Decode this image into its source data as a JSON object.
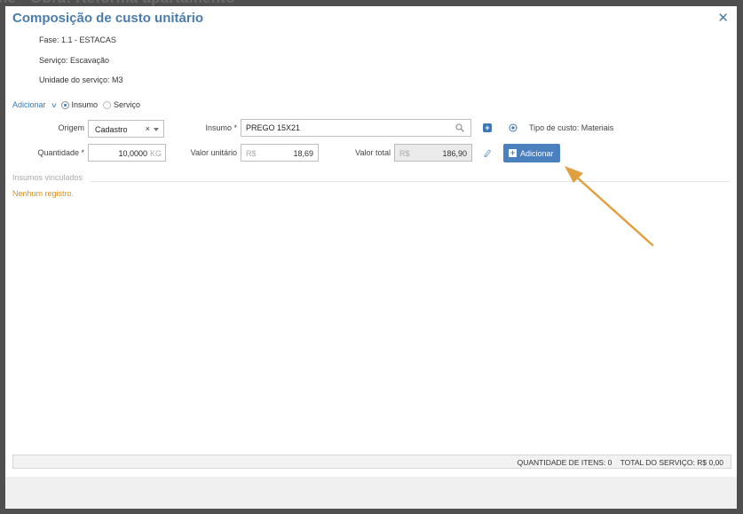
{
  "background": {
    "title": "ne - Obra: Reforma apartamento"
  },
  "modal": {
    "title": "Composição de custo unitário",
    "close_icon": "close-icon"
  },
  "info": {
    "fase": "Fase: 1.1 - ESTACAS",
    "servico": "Serviço: Escavação",
    "unidade": "Unidade do serviço: M3"
  },
  "add_mode": {
    "label": "Adicionar",
    "options": [
      {
        "label": "Insumo",
        "selected": true
      },
      {
        "label": "Serviço",
        "selected": false
      }
    ]
  },
  "form": {
    "origem_label": "Origem",
    "origem_value": "Cadastro",
    "insumo_label": "Insumo *",
    "insumo_value": "PREGO 15X21",
    "tipo_custo": "Tipo de custo: Materiais",
    "quantidade_label": "Quantidade *",
    "quantidade_value": "10,0000",
    "quantidade_unit": "KG",
    "valor_unitario_label": "Valor unitário",
    "valor_unitario_prefix": "R$",
    "valor_unitario_value": "18,69",
    "valor_total_label": "Valor total",
    "valor_total_prefix": "R$",
    "valor_total_value": "186,90",
    "add_button_label": "Adicionar"
  },
  "linked": {
    "title": "Insumos vinculados",
    "empty_message": "Nenhum registro."
  },
  "footer": {
    "summary": "QUANTIDADE DE ITENS: 0    TOTAL DO SERVIÇO: R$ 0,00"
  },
  "colors": {
    "accent": "#4a7cae",
    "button": "#4a80bd",
    "warning_text": "#e0901f",
    "annotation_arrow": "#e0a040"
  }
}
